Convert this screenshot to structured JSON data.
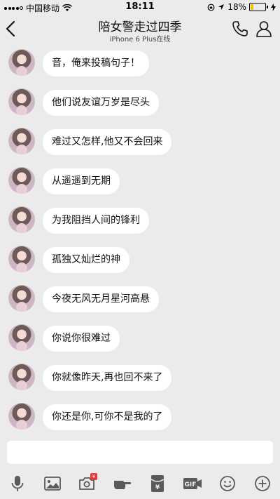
{
  "status_bar": {
    "carrier": "中国移动",
    "time": "18:11",
    "battery_percent": "18%",
    "battery_level": 0.18
  },
  "nav": {
    "title": "陪女警走过四季",
    "subtitle": "iPhone 6 Plus在线"
  },
  "messages": [
    {
      "text": "音，俺来投稿句子！"
    },
    {
      "text": "他们说友谊万岁是尽头"
    },
    {
      "text": "难过又怎样,他又不会回来"
    },
    {
      "text": "从遥遥到无期"
    },
    {
      "text": "为我阻挡人间的锋利"
    },
    {
      "text": "孤独又灿烂的神"
    },
    {
      "text": "今夜无风无月星河高悬"
    },
    {
      "text": "你说你很难过"
    },
    {
      "text": "你就像昨天,再也回不来了"
    },
    {
      "text": "你还是你,可你不是我的了"
    }
  ],
  "toolbar": {
    "icons": [
      "microphone-icon",
      "image-icon",
      "camera-icon",
      "poke-icon",
      "red-packet-icon",
      "gif-icon",
      "emoji-icon",
      "plus-icon"
    ],
    "redpacket_symbol": "¥",
    "gif_label": "GIF"
  },
  "colors": {
    "background": "#ebebeb",
    "bubble": "#ffffff",
    "battery": "#f5c400"
  }
}
